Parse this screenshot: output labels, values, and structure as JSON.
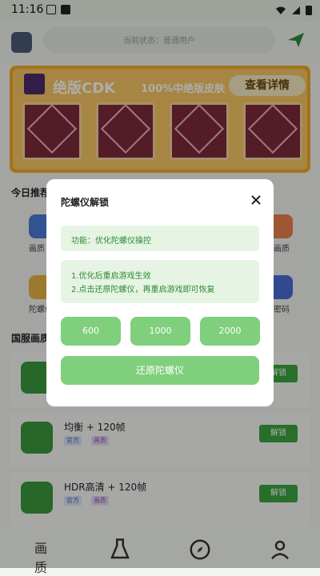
{
  "status_bar": {
    "time": "11:16"
  },
  "header": {
    "search_text": "当前状态：普通用户"
  },
  "banner": {
    "title": "绝版CDK",
    "subtitle": "100%中绝版皮肤",
    "cta": "查看详情"
  },
  "sections": {
    "today_recommend": "今日推荐",
    "grid_labels": [
      "画质",
      "陀螺仪",
      "画质",
      "密码"
    ],
    "list_title": "国服画质"
  },
  "list": [
    {
      "title": "",
      "tags": [],
      "button": "解锁"
    },
    {
      "title": "均衡 + 120帧",
      "tags": [
        "官方",
        "画质"
      ],
      "button": "解锁"
    },
    {
      "title": "HDR高清 + 120帧",
      "tags": [
        "官方",
        "画质"
      ],
      "button": "解锁"
    }
  ],
  "bottom_nav": {
    "home_label": "画质"
  },
  "modal": {
    "title": "陀螺仪解锁",
    "close_icon": "close-icon",
    "info": "功能：优化陀螺仪操控",
    "steps": [
      "1.优化后重启游戏生效",
      "2.点击还原陀螺仪，再重启游戏即可恢复"
    ],
    "options": [
      "600",
      "1000",
      "2000"
    ],
    "restore": "还原陀螺仪"
  },
  "colors": {
    "accent": "#7fcf7c",
    "info_bg": "#e6f4e4",
    "info_text": "#2d8a34"
  }
}
